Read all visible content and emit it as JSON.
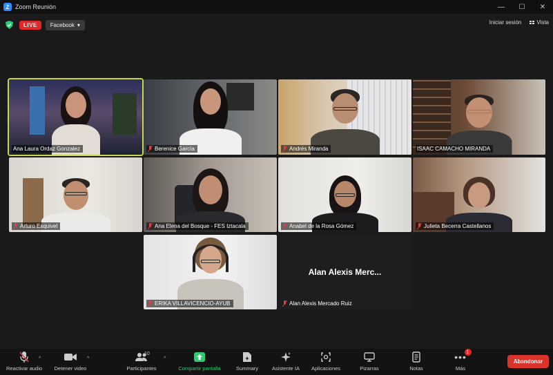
{
  "window": {
    "title": "Zoom Reunión",
    "min": "—",
    "max": "☐",
    "close": "✕"
  },
  "meeting": {
    "live_label": "LIVE",
    "stream_target": "Facebook",
    "signin": "Iniciar sesión",
    "view": "Vista"
  },
  "participants": [
    {
      "name": "Ana Laura Ordaz Gonzalez",
      "muted": false,
      "active": true
    },
    {
      "name": "Berenice García",
      "muted": true
    },
    {
      "name": "Andrés Miranda",
      "muted": true
    },
    {
      "name": "ISAAC CAMACHO MIRANDA",
      "muted": true
    },
    {
      "name": "Arturo Esquivel",
      "muted": true
    },
    {
      "name": "Ana Elena del Bosque - FES Iztacala",
      "muted": true
    },
    {
      "name": "Anabel de la Rosa Gómez",
      "muted": true
    },
    {
      "name": "Julieta Becerra Castellanos",
      "muted": true
    },
    {
      "name": "ERIKA VILLAVICENCIO-AYUB",
      "muted": true
    },
    {
      "name": "Alan Alexis Mercado Ruiz",
      "display_name": "Alan Alexis Merc...",
      "muted": true,
      "camera": "off"
    }
  ],
  "toolbar": {
    "audio": "Reactivar audio",
    "video": "Detener video",
    "participants": "Participantes",
    "participants_count": "10",
    "share": "Compartir pantalla",
    "summary": "Summary",
    "ai": "Asistente IA",
    "apps": "Aplicaciones",
    "whiteboards": "Pizarras",
    "notes": "Notas",
    "more": "Más",
    "more_badge": "1",
    "leave": "Abandonar",
    "caret": "^"
  },
  "colors": {
    "accent": "#2d8cff",
    "active_speaker": "#c8d84a",
    "live": "#e02828",
    "leave": "#d9342b",
    "share": "#2ecc71"
  }
}
